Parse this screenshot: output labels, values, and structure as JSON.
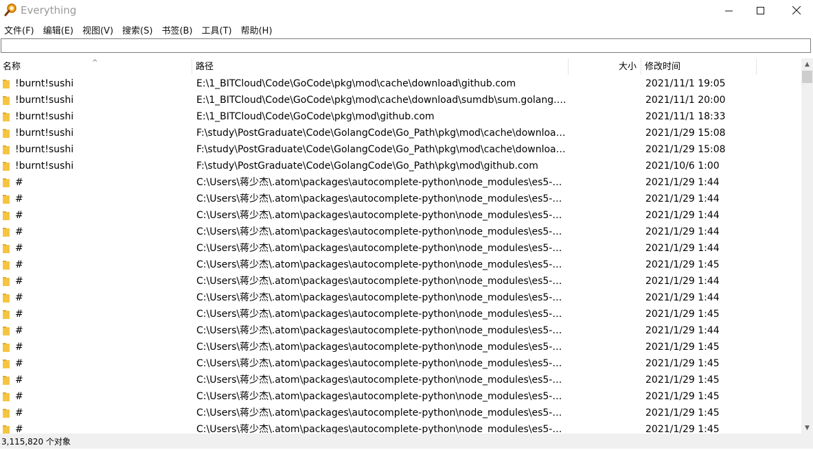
{
  "window": {
    "title": "Everything"
  },
  "menu": [
    "文件(F)",
    "编辑(E)",
    "视图(V)",
    "搜索(S)",
    "书签(B)",
    "工具(T)",
    "帮助(H)"
  ],
  "search": {
    "value": ""
  },
  "columns": {
    "name": "名称",
    "path": "路径",
    "size": "大小",
    "date": "修改时间"
  },
  "rows": [
    {
      "name": "!burnt!sushi",
      "path": "E:\\1_BITCloud\\Code\\GoCode\\pkg\\mod\\cache\\download\\github.com",
      "size": "",
      "date": "2021/11/1 19:05"
    },
    {
      "name": "!burnt!sushi",
      "path": "E:\\1_BITCloud\\Code\\GoCode\\pkg\\mod\\cache\\download\\sumdb\\sum.golang.o...",
      "size": "",
      "date": "2021/11/1 20:00"
    },
    {
      "name": "!burnt!sushi",
      "path": "E:\\1_BITCloud\\Code\\GoCode\\pkg\\mod\\github.com",
      "size": "",
      "date": "2021/11/1 18:33"
    },
    {
      "name": "!burnt!sushi",
      "path": "F:\\study\\PostGraduate\\Code\\GolangCode\\Go_Path\\pkg\\mod\\cache\\download...",
      "size": "",
      "date": "2021/1/29 15:08"
    },
    {
      "name": "!burnt!sushi",
      "path": "F:\\study\\PostGraduate\\Code\\GolangCode\\Go_Path\\pkg\\mod\\cache\\download...",
      "size": "",
      "date": "2021/1/29 15:08"
    },
    {
      "name": "!burnt!sushi",
      "path": "F:\\study\\PostGraduate\\Code\\GolangCode\\Go_Path\\pkg\\mod\\github.com",
      "size": "",
      "date": "2021/10/6 1:00"
    },
    {
      "name": "#",
      "path": "C:\\Users\\蒋少杰\\.atom\\packages\\autocomplete-python\\node_modules\\es5-ext...",
      "size": "",
      "date": "2021/1/29 1:44"
    },
    {
      "name": "#",
      "path": "C:\\Users\\蒋少杰\\.atom\\packages\\autocomplete-python\\node_modules\\es5-ext...",
      "size": "",
      "date": "2021/1/29 1:44"
    },
    {
      "name": "#",
      "path": "C:\\Users\\蒋少杰\\.atom\\packages\\autocomplete-python\\node_modules\\es5-ext...",
      "size": "",
      "date": "2021/1/29 1:44"
    },
    {
      "name": "#",
      "path": "C:\\Users\\蒋少杰\\.atom\\packages\\autocomplete-python\\node_modules\\es5-ext...",
      "size": "",
      "date": "2021/1/29 1:44"
    },
    {
      "name": "#",
      "path": "C:\\Users\\蒋少杰\\.atom\\packages\\autocomplete-python\\node_modules\\es5-ext...",
      "size": "",
      "date": "2021/1/29 1:44"
    },
    {
      "name": "#",
      "path": "C:\\Users\\蒋少杰\\.atom\\packages\\autocomplete-python\\node_modules\\es5-ext...",
      "size": "",
      "date": "2021/1/29 1:45"
    },
    {
      "name": "#",
      "path": "C:\\Users\\蒋少杰\\.atom\\packages\\autocomplete-python\\node_modules\\es5-ext...",
      "size": "",
      "date": "2021/1/29 1:44"
    },
    {
      "name": "#",
      "path": "C:\\Users\\蒋少杰\\.atom\\packages\\autocomplete-python\\node_modules\\es5-ext...",
      "size": "",
      "date": "2021/1/29 1:44"
    },
    {
      "name": "#",
      "path": "C:\\Users\\蒋少杰\\.atom\\packages\\autocomplete-python\\node_modules\\es5-ext...",
      "size": "",
      "date": "2021/1/29 1:45"
    },
    {
      "name": "#",
      "path": "C:\\Users\\蒋少杰\\.atom\\packages\\autocomplete-python\\node_modules\\es5-ext...",
      "size": "",
      "date": "2021/1/29 1:44"
    },
    {
      "name": "#",
      "path": "C:\\Users\\蒋少杰\\.atom\\packages\\autocomplete-python\\node_modules\\es5-ext...",
      "size": "",
      "date": "2021/1/29 1:45"
    },
    {
      "name": "#",
      "path": "C:\\Users\\蒋少杰\\.atom\\packages\\autocomplete-python\\node_modules\\es5-ext...",
      "size": "",
      "date": "2021/1/29 1:45"
    },
    {
      "name": "#",
      "path": "C:\\Users\\蒋少杰\\.atom\\packages\\autocomplete-python\\node_modules\\es5-ext...",
      "size": "",
      "date": "2021/1/29 1:45"
    },
    {
      "name": "#",
      "path": "C:\\Users\\蒋少杰\\.atom\\packages\\autocomplete-python\\node_modules\\es5-ext...",
      "size": "",
      "date": "2021/1/29 1:45"
    },
    {
      "name": "#",
      "path": "C:\\Users\\蒋少杰\\.atom\\packages\\autocomplete-python\\node_modules\\es5-ext...",
      "size": "",
      "date": "2021/1/29 1:45"
    },
    {
      "name": "#",
      "path": "C:\\Users\\蒋少杰\\.atom\\packages\\autocomplete-python\\node_modules\\es5-ext...",
      "size": "",
      "date": "2021/1/29 1:45"
    }
  ],
  "status": {
    "count_text": "3,115,820 个对象"
  },
  "icons": {
    "app": "magnifier-icon",
    "row": "folder-icon"
  },
  "colors": {
    "folder": "#f5c542",
    "title_text": "#999999"
  }
}
